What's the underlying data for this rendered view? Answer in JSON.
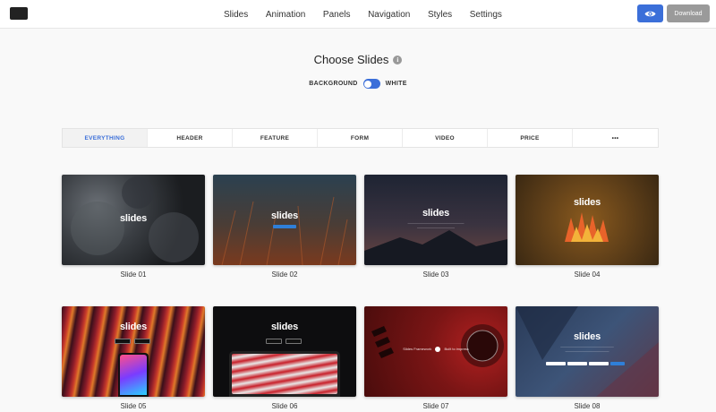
{
  "nav": {
    "items": [
      "Slides",
      "Animation",
      "Panels",
      "Navigation",
      "Styles",
      "Settings"
    ],
    "preview_icon": "eye-icon",
    "download_label": "Download"
  },
  "heading": {
    "title": "Choose Slides",
    "info_icon": "i",
    "toggle_left": "BACKGROUND",
    "toggle_right": "WHITE"
  },
  "tabs": [
    "EVERYTHING",
    "HEADER",
    "FEATURE",
    "FORM",
    "VIDEO",
    "PRICE",
    "•••"
  ],
  "slides": [
    {
      "name": "Slide 01",
      "brand": "slides"
    },
    {
      "name": "Slide 02",
      "brand": "slides"
    },
    {
      "name": "Slide 03",
      "brand": "slides"
    },
    {
      "name": "Slide 04",
      "brand": "slides"
    },
    {
      "name": "Slide 05",
      "brand": "slides"
    },
    {
      "name": "Slide 06",
      "brand": "slides"
    },
    {
      "name": "Slide 07",
      "brand": ""
    },
    {
      "name": "Slide 08",
      "brand": "slides"
    }
  ],
  "slide07": {
    "left_text": "Slides Framework",
    "right_text": "Built to impress"
  },
  "colors": {
    "accent": "#3b6fd9",
    "download_bg": "#9a9a9a"
  }
}
